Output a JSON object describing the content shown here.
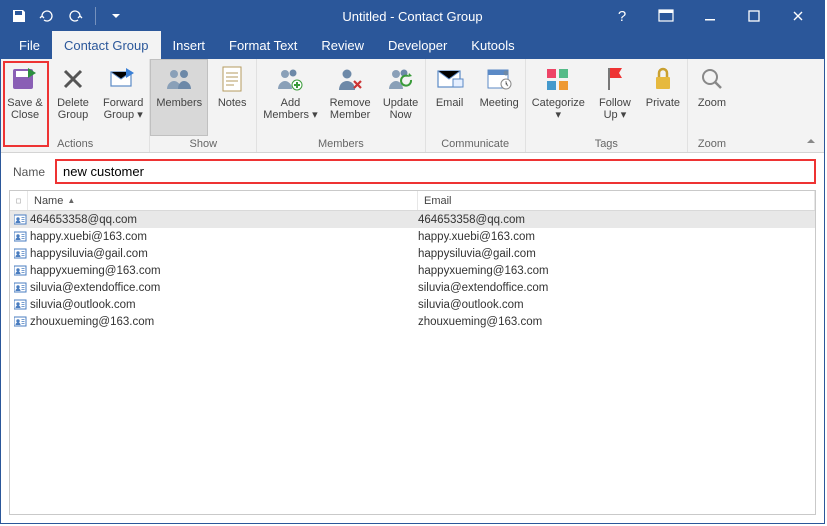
{
  "titlebar": {
    "title": "Untitled  -  Contact Group"
  },
  "tabs": {
    "file": "File",
    "contact_group": "Contact Group",
    "insert": "Insert",
    "format_text": "Format Text",
    "review": "Review",
    "developer": "Developer",
    "kutools": "Kutools"
  },
  "ribbon": {
    "save_close": "Save &\nClose",
    "delete_group": "Delete\nGroup",
    "forward_group": "Forward\nGroup ▾",
    "members": "Members",
    "notes": "Notes",
    "add_members": "Add\nMembers ▾",
    "remove_member": "Remove\nMember",
    "update_now": "Update\nNow",
    "email": "Email",
    "meeting": "Meeting",
    "categorize": "Categorize\n▾",
    "follow_up": "Follow\nUp ▾",
    "private": "Private",
    "zoom": "Zoom",
    "group_actions": "Actions",
    "group_show": "Show",
    "group_members": "Members",
    "group_communicate": "Communicate",
    "group_tags": "Tags",
    "group_zoom": "Zoom"
  },
  "name_field": {
    "label": "Name",
    "value": "new customer"
  },
  "list": {
    "col_name": "Name",
    "col_email": "Email",
    "rows": [
      {
        "name": "464653358@qq.com",
        "email": "464653358@qq.com",
        "sel": true
      },
      {
        "name": "happy.xuebi@163.com",
        "email": "happy.xuebi@163.com",
        "sel": false
      },
      {
        "name": "happysiluvia@gail.com",
        "email": "happysiluvia@gail.com",
        "sel": false
      },
      {
        "name": "happyxueming@163.com",
        "email": "happyxueming@163.com",
        "sel": false
      },
      {
        "name": "siluvia@extendoffice.com",
        "email": "siluvia@extendoffice.com",
        "sel": false
      },
      {
        "name": "siluvia@outlook.com",
        "email": "siluvia@outlook.com",
        "sel": false
      },
      {
        "name": "zhouxueming@163.com",
        "email": "zhouxueming@163.com",
        "sel": false
      }
    ]
  }
}
